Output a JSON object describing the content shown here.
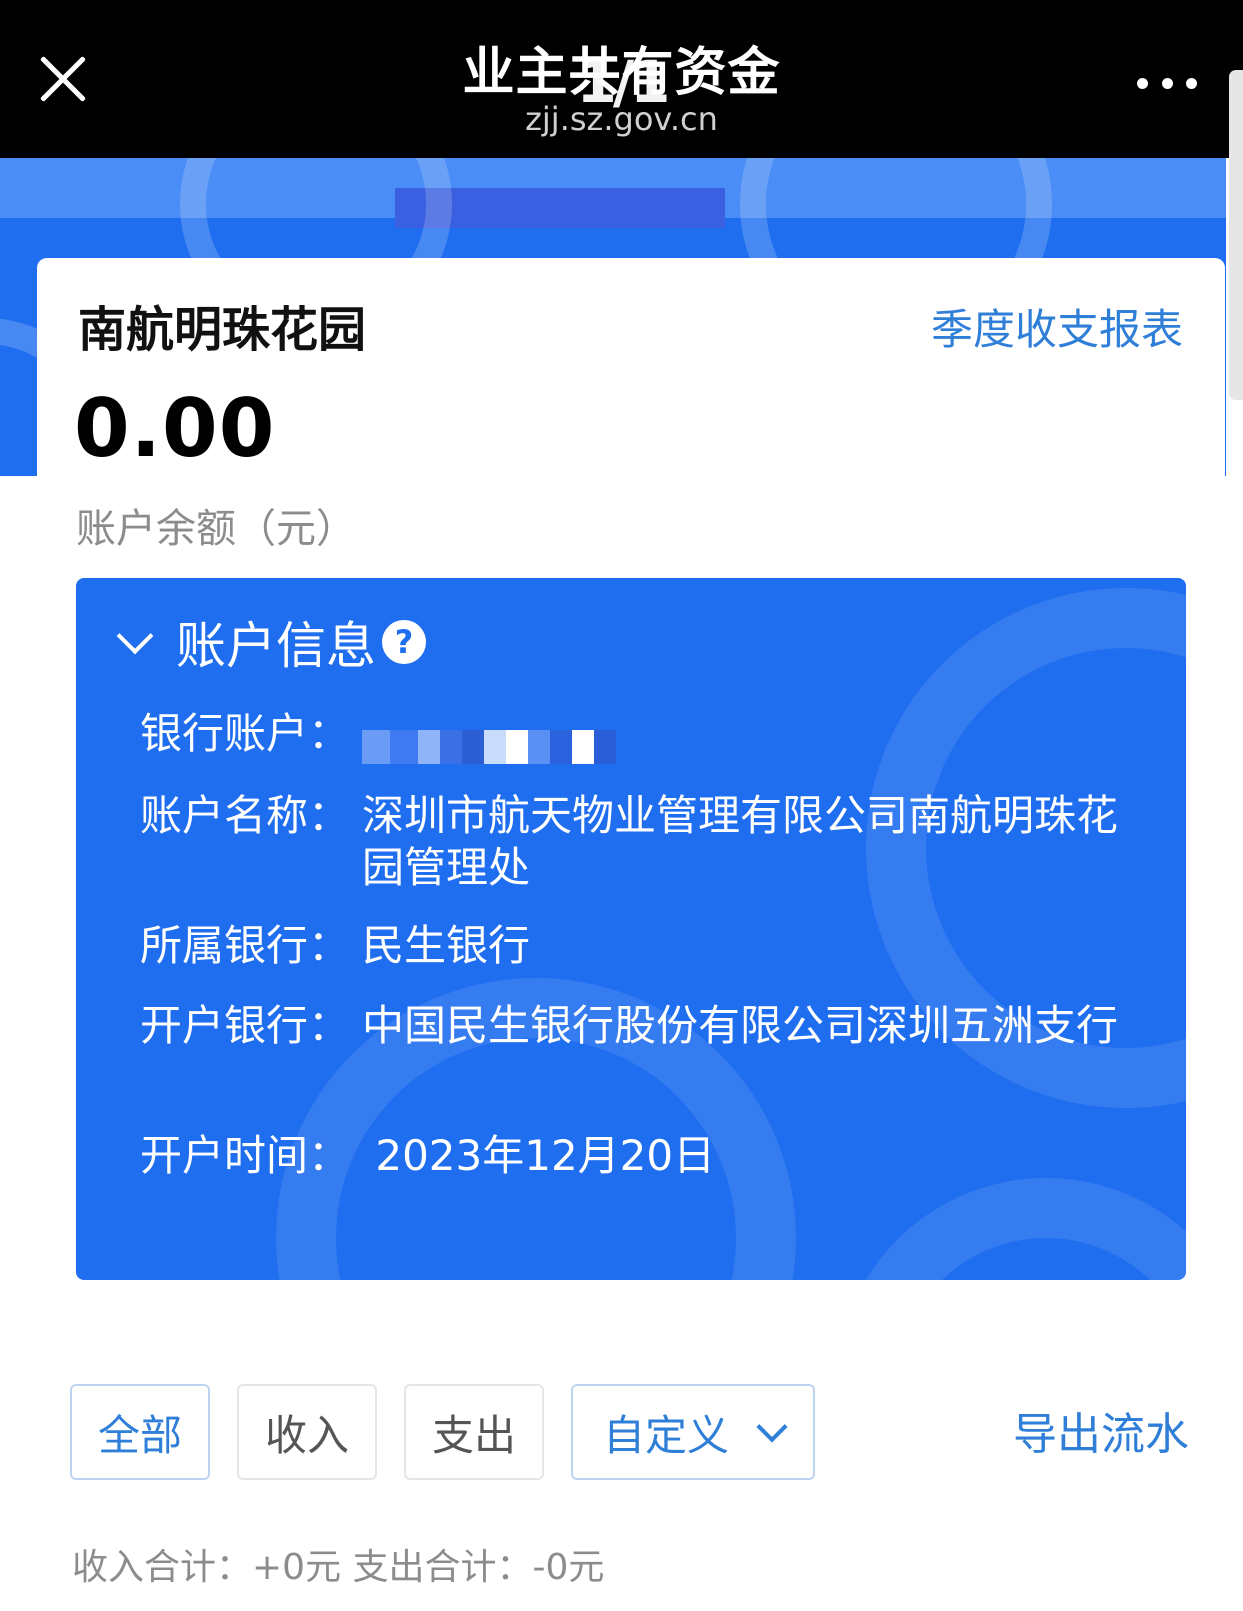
{
  "topbar": {
    "title": "业主共有资金",
    "page_counter": "1/1",
    "domain": "zjj.sz.gov.cn",
    "close_icon": "close-icon",
    "more_icon": "more-icon"
  },
  "header": {
    "community_name": "南航明珠花园",
    "report_link": "季度收支报表",
    "balance": "0.00",
    "balance_label": "账户余额（元）"
  },
  "account_info": {
    "title": "账户信息",
    "help_glyph": "?",
    "rows": [
      {
        "label": "银行账户：",
        "value": ""
      },
      {
        "label": "账户名称：",
        "value": "深圳市航天物业管理有限公司南航明珠花园管理处"
      },
      {
        "label": "所属银行：",
        "value": "民生银行"
      },
      {
        "label": "开户银行：",
        "value": "中国民生银行股份有限公司深圳五洲支行"
      },
      {
        "label": "开户时间：",
        "value": " 2023年12月20日"
      }
    ]
  },
  "filters": {
    "all": "全部",
    "income": "收入",
    "expense": "支出",
    "custom": "自定义",
    "active": "全部"
  },
  "export_link": "导出流水",
  "summary": "收入合计：+0元 支出合计：-0元",
  "colors": {
    "accent_blue": "#1f6ef0",
    "link_blue": "#2f7fd8",
    "topbar": "#000000"
  }
}
